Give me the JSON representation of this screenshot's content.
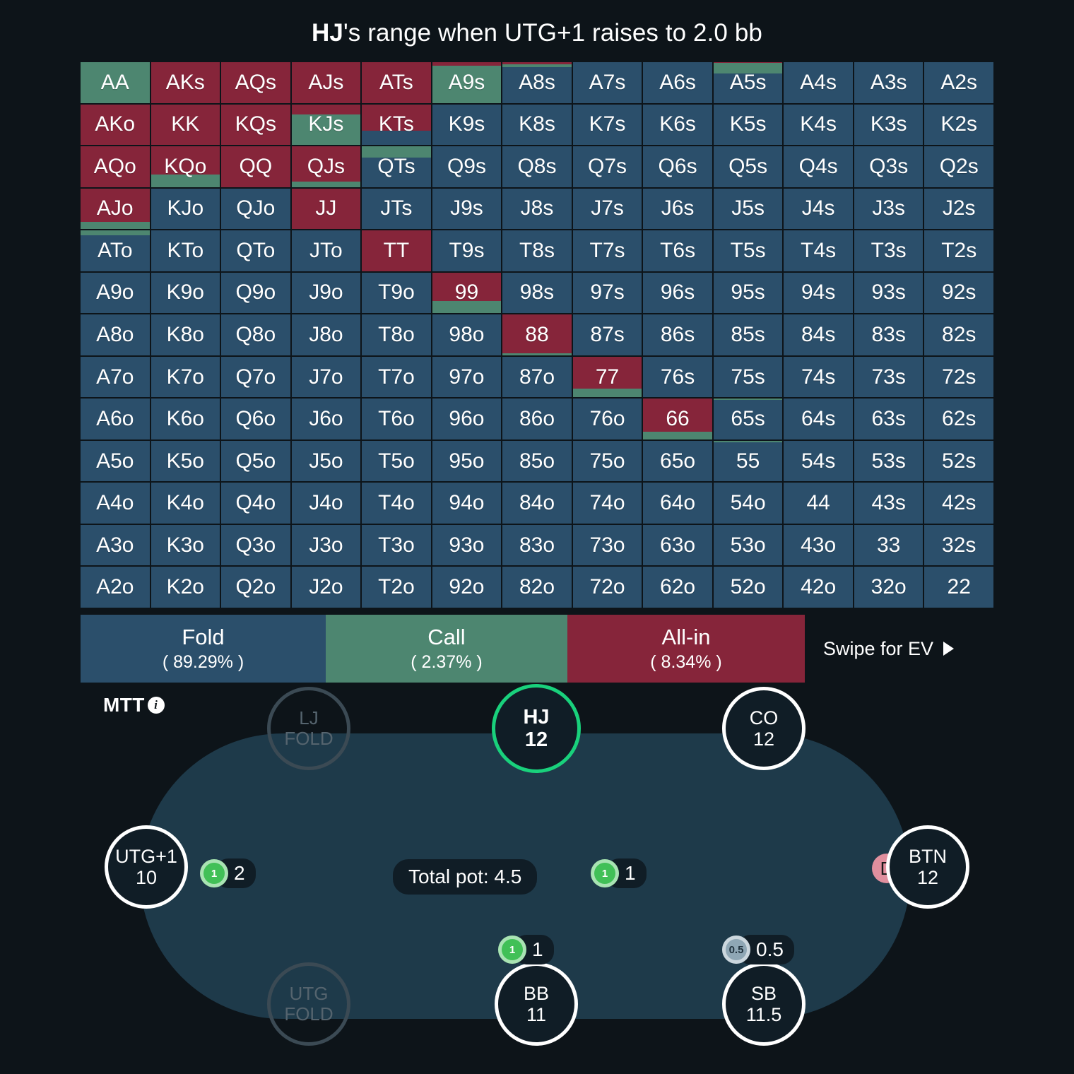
{
  "title": {
    "hero": "HJ",
    "rest": "'s range when UTG+1 raises to 2.0 bb"
  },
  "colors": {
    "fold": "#2b4f6b",
    "call": "#4d8670",
    "allin": "#86253a",
    "hero_ring": "#19d17c",
    "felt": "#1e3a4a",
    "background": "#0d1419"
  },
  "chart_data": {
    "type": "heatmap",
    "title": "HJ's range when UTG+1 raises to 2.0 bb",
    "legend_position": "bottom",
    "actions": [
      "Fold",
      "Call",
      "All-in"
    ],
    "action_colors": [
      "#2b4f6b",
      "#4d8670",
      "#86253a"
    ],
    "ranks": [
      "A",
      "K",
      "Q",
      "J",
      "T",
      "9",
      "8",
      "7",
      "6",
      "5",
      "4",
      "3",
      "2"
    ],
    "note": "Each cell: [fold%, call%, allin%] stacked bottom-to-top as fold(bottom), call(middle), allin(top)",
    "cells": [
      [
        {
          "h": "AA",
          "f": 0,
          "c": 100,
          "a": 0
        },
        {
          "h": "AKs",
          "f": 0,
          "c": 0,
          "a": 100
        },
        {
          "h": "AQs",
          "f": 0,
          "c": 0,
          "a": 100
        },
        {
          "h": "AJs",
          "f": 0,
          "c": 0,
          "a": 100
        },
        {
          "h": "ATs",
          "f": 0,
          "c": 0,
          "a": 100
        },
        {
          "h": "A9s",
          "f": 0,
          "c": 92,
          "a": 8
        },
        {
          "h": "A8s",
          "f": 88,
          "c": 6,
          "a": 6
        },
        {
          "h": "A7s",
          "f": 100,
          "c": 0,
          "a": 0
        },
        {
          "h": "A6s",
          "f": 100,
          "c": 0,
          "a": 0
        },
        {
          "h": "A5s",
          "f": 72,
          "c": 26,
          "a": 2
        },
        {
          "h": "A4s",
          "f": 100,
          "c": 0,
          "a": 0
        },
        {
          "h": "A3s",
          "f": 100,
          "c": 0,
          "a": 0
        },
        {
          "h": "A2s",
          "f": 100,
          "c": 0,
          "a": 0
        }
      ],
      [
        {
          "h": "AKo",
          "f": 0,
          "c": 0,
          "a": 100
        },
        {
          "h": "KK",
          "f": 0,
          "c": 0,
          "a": 100
        },
        {
          "h": "KQs",
          "f": 0,
          "c": 0,
          "a": 100
        },
        {
          "h": "KJs",
          "f": 0,
          "c": 74,
          "a": 26
        },
        {
          "h": "KTs",
          "f": 35,
          "c": 0,
          "a": 65
        },
        {
          "h": "K9s",
          "f": 100,
          "c": 0,
          "a": 0
        },
        {
          "h": "K8s",
          "f": 100,
          "c": 0,
          "a": 0
        },
        {
          "h": "K7s",
          "f": 100,
          "c": 0,
          "a": 0
        },
        {
          "h": "K6s",
          "f": 100,
          "c": 0,
          "a": 0
        },
        {
          "h": "K5s",
          "f": 100,
          "c": 0,
          "a": 0
        },
        {
          "h": "K4s",
          "f": 100,
          "c": 0,
          "a": 0
        },
        {
          "h": "K3s",
          "f": 100,
          "c": 0,
          "a": 0
        },
        {
          "h": "K2s",
          "f": 100,
          "c": 0,
          "a": 0
        }
      ],
      [
        {
          "h": "AQo",
          "f": 0,
          "c": 0,
          "a": 100
        },
        {
          "h": "KQo",
          "f": 0,
          "c": 30,
          "a": 70
        },
        {
          "h": "QQ",
          "f": 0,
          "c": 0,
          "a": 100
        },
        {
          "h": "QJs",
          "f": 0,
          "c": 13,
          "a": 87
        },
        {
          "h": "QTs",
          "f": 72,
          "c": 28,
          "a": 0
        },
        {
          "h": "Q9s",
          "f": 100,
          "c": 0,
          "a": 0
        },
        {
          "h": "Q8s",
          "f": 100,
          "c": 0,
          "a": 0
        },
        {
          "h": "Q7s",
          "f": 100,
          "c": 0,
          "a": 0
        },
        {
          "h": "Q6s",
          "f": 100,
          "c": 0,
          "a": 0
        },
        {
          "h": "Q5s",
          "f": 100,
          "c": 0,
          "a": 0
        },
        {
          "h": "Q4s",
          "f": 100,
          "c": 0,
          "a": 0
        },
        {
          "h": "Q3s",
          "f": 100,
          "c": 0,
          "a": 0
        },
        {
          "h": "Q2s",
          "f": 100,
          "c": 0,
          "a": 0
        }
      ],
      [
        {
          "h": "AJo",
          "f": 0,
          "c": 17,
          "a": 83
        },
        {
          "h": "KJo",
          "f": 100,
          "c": 0,
          "a": 0
        },
        {
          "h": "QJo",
          "f": 100,
          "c": 0,
          "a": 0
        },
        {
          "h": "JJ",
          "f": 0,
          "c": 0,
          "a": 100
        },
        {
          "h": "JTs",
          "f": 100,
          "c": 0,
          "a": 0
        },
        {
          "h": "J9s",
          "f": 100,
          "c": 0,
          "a": 0
        },
        {
          "h": "J8s",
          "f": 100,
          "c": 0,
          "a": 0
        },
        {
          "h": "J7s",
          "f": 100,
          "c": 0,
          "a": 0
        },
        {
          "h": "J6s",
          "f": 100,
          "c": 0,
          "a": 0
        },
        {
          "h": "J5s",
          "f": 100,
          "c": 0,
          "a": 0
        },
        {
          "h": "J4s",
          "f": 100,
          "c": 0,
          "a": 0
        },
        {
          "h": "J3s",
          "f": 100,
          "c": 0,
          "a": 0
        },
        {
          "h": "J2s",
          "f": 100,
          "c": 0,
          "a": 0
        }
      ],
      [
        {
          "h": "ATo",
          "f": 88,
          "c": 12,
          "a": 0
        },
        {
          "h": "KTo",
          "f": 100,
          "c": 0,
          "a": 0
        },
        {
          "h": "QTo",
          "f": 100,
          "c": 0,
          "a": 0
        },
        {
          "h": "JTo",
          "f": 100,
          "c": 0,
          "a": 0
        },
        {
          "h": "TT",
          "f": 0,
          "c": 0,
          "a": 100
        },
        {
          "h": "T9s",
          "f": 100,
          "c": 0,
          "a": 0
        },
        {
          "h": "T8s",
          "f": 100,
          "c": 0,
          "a": 0
        },
        {
          "h": "T7s",
          "f": 100,
          "c": 0,
          "a": 0
        },
        {
          "h": "T6s",
          "f": 100,
          "c": 0,
          "a": 0
        },
        {
          "h": "T5s",
          "f": 100,
          "c": 0,
          "a": 0
        },
        {
          "h": "T4s",
          "f": 100,
          "c": 0,
          "a": 0
        },
        {
          "h": "T3s",
          "f": 100,
          "c": 0,
          "a": 0
        },
        {
          "h": "T2s",
          "f": 100,
          "c": 0,
          "a": 0
        }
      ],
      [
        {
          "h": "A9o",
          "f": 100,
          "c": 0,
          "a": 0
        },
        {
          "h": "K9o",
          "f": 100,
          "c": 0,
          "a": 0
        },
        {
          "h": "Q9o",
          "f": 100,
          "c": 0,
          "a": 0
        },
        {
          "h": "J9o",
          "f": 100,
          "c": 0,
          "a": 0
        },
        {
          "h": "T9o",
          "f": 100,
          "c": 0,
          "a": 0
        },
        {
          "h": "99",
          "f": 0,
          "c": 30,
          "a": 70
        },
        {
          "h": "98s",
          "f": 100,
          "c": 0,
          "a": 0
        },
        {
          "h": "97s",
          "f": 100,
          "c": 0,
          "a": 0
        },
        {
          "h": "96s",
          "f": 100,
          "c": 0,
          "a": 0
        },
        {
          "h": "95s",
          "f": 100,
          "c": 0,
          "a": 0
        },
        {
          "h": "94s",
          "f": 100,
          "c": 0,
          "a": 0
        },
        {
          "h": "93s",
          "f": 100,
          "c": 0,
          "a": 0
        },
        {
          "h": "92s",
          "f": 100,
          "c": 0,
          "a": 0
        }
      ],
      [
        {
          "h": "A8o",
          "f": 100,
          "c": 0,
          "a": 0
        },
        {
          "h": "K8o",
          "f": 100,
          "c": 0,
          "a": 0
        },
        {
          "h": "Q8o",
          "f": 100,
          "c": 0,
          "a": 0
        },
        {
          "h": "J8o",
          "f": 100,
          "c": 0,
          "a": 0
        },
        {
          "h": "T8o",
          "f": 100,
          "c": 0,
          "a": 0
        },
        {
          "h": "98o",
          "f": 100,
          "c": 0,
          "a": 0
        },
        {
          "h": "88",
          "f": 0,
          "c": 5,
          "a": 95
        },
        {
          "h": "87s",
          "f": 100,
          "c": 0,
          "a": 0
        },
        {
          "h": "86s",
          "f": 100,
          "c": 0,
          "a": 0
        },
        {
          "h": "85s",
          "f": 100,
          "c": 0,
          "a": 0
        },
        {
          "h": "84s",
          "f": 100,
          "c": 0,
          "a": 0
        },
        {
          "h": "83s",
          "f": 100,
          "c": 0,
          "a": 0
        },
        {
          "h": "82s",
          "f": 100,
          "c": 0,
          "a": 0
        }
      ],
      [
        {
          "h": "A7o",
          "f": 100,
          "c": 0,
          "a": 0
        },
        {
          "h": "K7o",
          "f": 100,
          "c": 0,
          "a": 0
        },
        {
          "h": "Q7o",
          "f": 100,
          "c": 0,
          "a": 0
        },
        {
          "h": "J7o",
          "f": 100,
          "c": 0,
          "a": 0
        },
        {
          "h": "T7o",
          "f": 100,
          "c": 0,
          "a": 0
        },
        {
          "h": "97o",
          "f": 100,
          "c": 0,
          "a": 0
        },
        {
          "h": "87o",
          "f": 100,
          "c": 0,
          "a": 0
        },
        {
          "h": "77",
          "f": 0,
          "c": 22,
          "a": 78
        },
        {
          "h": "76s",
          "f": 100,
          "c": 0,
          "a": 0
        },
        {
          "h": "75s",
          "f": 100,
          "c": 0,
          "a": 0
        },
        {
          "h": "74s",
          "f": 100,
          "c": 0,
          "a": 0
        },
        {
          "h": "73s",
          "f": 100,
          "c": 0,
          "a": 0
        },
        {
          "h": "72s",
          "f": 100,
          "c": 0,
          "a": 0
        }
      ],
      [
        {
          "h": "A6o",
          "f": 100,
          "c": 0,
          "a": 0
        },
        {
          "h": "K6o",
          "f": 100,
          "c": 0,
          "a": 0
        },
        {
          "h": "Q6o",
          "f": 100,
          "c": 0,
          "a": 0
        },
        {
          "h": "J6o",
          "f": 100,
          "c": 0,
          "a": 0
        },
        {
          "h": "T6o",
          "f": 100,
          "c": 0,
          "a": 0
        },
        {
          "h": "96o",
          "f": 100,
          "c": 0,
          "a": 0
        },
        {
          "h": "86o",
          "f": 100,
          "c": 0,
          "a": 0
        },
        {
          "h": "76o",
          "f": 100,
          "c": 0,
          "a": 0
        },
        {
          "h": "66",
          "f": 0,
          "c": 18,
          "a": 82
        },
        {
          "h": "65s",
          "f": 97,
          "c": 3,
          "a": 0
        },
        {
          "h": "64s",
          "f": 100,
          "c": 0,
          "a": 0
        },
        {
          "h": "63s",
          "f": 100,
          "c": 0,
          "a": 0
        },
        {
          "h": "62s",
          "f": 100,
          "c": 0,
          "a": 0
        }
      ],
      [
        {
          "h": "A5o",
          "f": 100,
          "c": 0,
          "a": 0
        },
        {
          "h": "K5o",
          "f": 100,
          "c": 0,
          "a": 0
        },
        {
          "h": "Q5o",
          "f": 100,
          "c": 0,
          "a": 0
        },
        {
          "h": "J5o",
          "f": 100,
          "c": 0,
          "a": 0
        },
        {
          "h": "T5o",
          "f": 100,
          "c": 0,
          "a": 0
        },
        {
          "h": "95o",
          "f": 100,
          "c": 0,
          "a": 0
        },
        {
          "h": "85o",
          "f": 100,
          "c": 0,
          "a": 0
        },
        {
          "h": "75o",
          "f": 100,
          "c": 0,
          "a": 0
        },
        {
          "h": "65o",
          "f": 100,
          "c": 0,
          "a": 0
        },
        {
          "h": "55",
          "f": 96,
          "c": 4,
          "a": 0
        },
        {
          "h": "54s",
          "f": 100,
          "c": 0,
          "a": 0
        },
        {
          "h": "53s",
          "f": 100,
          "c": 0,
          "a": 0
        },
        {
          "h": "52s",
          "f": 100,
          "c": 0,
          "a": 0
        }
      ],
      [
        {
          "h": "A4o",
          "f": 100,
          "c": 0,
          "a": 0
        },
        {
          "h": "K4o",
          "f": 100,
          "c": 0,
          "a": 0
        },
        {
          "h": "Q4o",
          "f": 100,
          "c": 0,
          "a": 0
        },
        {
          "h": "J4o",
          "f": 100,
          "c": 0,
          "a": 0
        },
        {
          "h": "T4o",
          "f": 100,
          "c": 0,
          "a": 0
        },
        {
          "h": "94o",
          "f": 100,
          "c": 0,
          "a": 0
        },
        {
          "h": "84o",
          "f": 100,
          "c": 0,
          "a": 0
        },
        {
          "h": "74o",
          "f": 100,
          "c": 0,
          "a": 0
        },
        {
          "h": "64o",
          "f": 100,
          "c": 0,
          "a": 0
        },
        {
          "h": "54o",
          "f": 100,
          "c": 0,
          "a": 0
        },
        {
          "h": "44",
          "f": 100,
          "c": 0,
          "a": 0
        },
        {
          "h": "43s",
          "f": 100,
          "c": 0,
          "a": 0
        },
        {
          "h": "42s",
          "f": 100,
          "c": 0,
          "a": 0
        }
      ],
      [
        {
          "h": "A3o",
          "f": 100,
          "c": 0,
          "a": 0
        },
        {
          "h": "K3o",
          "f": 100,
          "c": 0,
          "a": 0
        },
        {
          "h": "Q3o",
          "f": 100,
          "c": 0,
          "a": 0
        },
        {
          "h": "J3o",
          "f": 100,
          "c": 0,
          "a": 0
        },
        {
          "h": "T3o",
          "f": 100,
          "c": 0,
          "a": 0
        },
        {
          "h": "93o",
          "f": 100,
          "c": 0,
          "a": 0
        },
        {
          "h": "83o",
          "f": 100,
          "c": 0,
          "a": 0
        },
        {
          "h": "73o",
          "f": 100,
          "c": 0,
          "a": 0
        },
        {
          "h": "63o",
          "f": 100,
          "c": 0,
          "a": 0
        },
        {
          "h": "53o",
          "f": 100,
          "c": 0,
          "a": 0
        },
        {
          "h": "43o",
          "f": 100,
          "c": 0,
          "a": 0
        },
        {
          "h": "33",
          "f": 100,
          "c": 0,
          "a": 0
        },
        {
          "h": "32s",
          "f": 100,
          "c": 0,
          "a": 0
        }
      ],
      [
        {
          "h": "A2o",
          "f": 100,
          "c": 0,
          "a": 0
        },
        {
          "h": "K2o",
          "f": 100,
          "c": 0,
          "a": 0
        },
        {
          "h": "Q2o",
          "f": 100,
          "c": 0,
          "a": 0
        },
        {
          "h": "J2o",
          "f": 100,
          "c": 0,
          "a": 0
        },
        {
          "h": "T2o",
          "f": 100,
          "c": 0,
          "a": 0
        },
        {
          "h": "92o",
          "f": 100,
          "c": 0,
          "a": 0
        },
        {
          "h": "82o",
          "f": 100,
          "c": 0,
          "a": 0
        },
        {
          "h": "72o",
          "f": 100,
          "c": 0,
          "a": 0
        },
        {
          "h": "62o",
          "f": 100,
          "c": 0,
          "a": 0
        },
        {
          "h": "52o",
          "f": 100,
          "c": 0,
          "a": 0
        },
        {
          "h": "42o",
          "f": 100,
          "c": 0,
          "a": 0
        },
        {
          "h": "32o",
          "f": 100,
          "c": 0,
          "a": 0
        },
        {
          "h": "22",
          "f": 100,
          "c": 0,
          "a": 0
        }
      ]
    ]
  },
  "legend": {
    "fold": {
      "name": "Fold",
      "pct": "( 89.29% )"
    },
    "call": {
      "name": "Call",
      "pct": "( 2.37% )"
    },
    "allin": {
      "name": "All-in",
      "pct": "( 8.34% )"
    },
    "swipe": "Swipe for EV"
  },
  "table": {
    "game_type": "MTT",
    "info_glyph": "i",
    "pot": "Total pot: 4.5",
    "dealer_badge": "D",
    "seats": [
      {
        "pos": "LJ",
        "stack": "FOLD",
        "state": "folded"
      },
      {
        "pos": "HJ",
        "stack": "12",
        "state": "hero"
      },
      {
        "pos": "CO",
        "stack": "12",
        "state": "active"
      },
      {
        "pos": "BTN",
        "stack": "12",
        "state": "active"
      },
      {
        "pos": "SB",
        "stack": "11.5",
        "state": "active"
      },
      {
        "pos": "BB",
        "stack": "11",
        "state": "active"
      },
      {
        "pos": "UTG",
        "stack": "FOLD",
        "state": "folded"
      },
      {
        "pos": "UTG+1",
        "stack": "10",
        "state": "active"
      }
    ],
    "bets": [
      {
        "owner": "UTG+1",
        "chip": "1",
        "amount": "2",
        "color": "green"
      },
      {
        "owner": "CO",
        "chip": "1",
        "amount": "1",
        "color": "green"
      },
      {
        "owner": "BB",
        "chip": "1",
        "amount": "1",
        "color": "green"
      },
      {
        "owner": "SB",
        "chip": "0.5",
        "amount": "0.5",
        "color": "blue"
      }
    ]
  }
}
